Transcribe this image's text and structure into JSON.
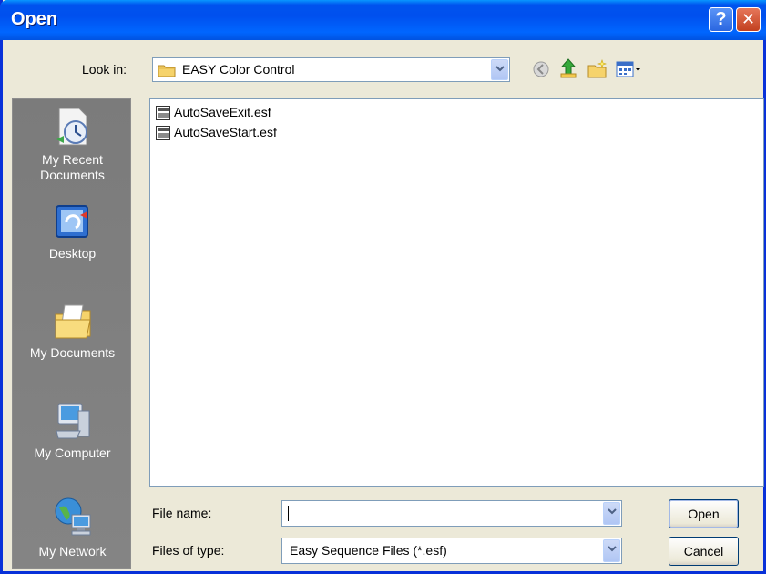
{
  "window": {
    "title": "Open"
  },
  "toolbar": {
    "look_in_label": "Look in:",
    "look_in_value": "EASY Color Control"
  },
  "places": [
    {
      "label": "My Recent Documents",
      "icon": "recent-documents-icon"
    },
    {
      "label": "Desktop",
      "icon": "desktop-icon"
    },
    {
      "label": "My Documents",
      "icon": "my-documents-icon"
    },
    {
      "label": "My Computer",
      "icon": "my-computer-icon"
    },
    {
      "label": "My Network",
      "icon": "my-network-icon"
    }
  ],
  "files": [
    {
      "name": "AutoSaveExit.esf"
    },
    {
      "name": "AutoSaveStart.esf"
    }
  ],
  "bottom": {
    "file_name_label": "File name:",
    "file_name_value": "",
    "file_type_label": "Files of type:",
    "file_type_value": "Easy Sequence Files (*.esf)",
    "open_label": "Open",
    "cancel_label": "Cancel"
  },
  "colors": {
    "titlebar": "#0054e3",
    "dialog_bg": "#ece9d8",
    "places_bar": "#808080"
  }
}
